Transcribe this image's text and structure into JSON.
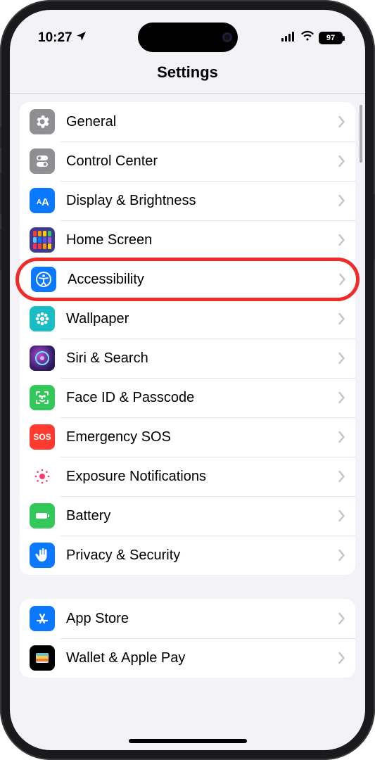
{
  "status": {
    "time": "10:27",
    "location_active": true,
    "battery": "97"
  },
  "title": "Settings",
  "highlighted_index": 4,
  "groups": [
    {
      "items": [
        {
          "id": "general",
          "label": "General",
          "icon": "gear-icon",
          "icon_class": "ic-general"
        },
        {
          "id": "control-center",
          "label": "Control Center",
          "icon": "toggles-icon",
          "icon_class": "ic-control"
        },
        {
          "id": "display",
          "label": "Display & Brightness",
          "icon": "text-size-icon",
          "icon_class": "ic-display"
        },
        {
          "id": "home-screen",
          "label": "Home Screen",
          "icon": "app-grid-icon",
          "icon_class": "ic-home"
        },
        {
          "id": "accessibility",
          "label": "Accessibility",
          "icon": "accessibility-icon",
          "icon_class": "ic-access"
        },
        {
          "id": "wallpaper",
          "label": "Wallpaper",
          "icon": "flower-icon",
          "icon_class": "ic-wall"
        },
        {
          "id": "siri",
          "label": "Siri & Search",
          "icon": "siri-icon",
          "icon_class": "ic-siri"
        },
        {
          "id": "face-id",
          "label": "Face ID & Passcode",
          "icon": "face-id-icon",
          "icon_class": "ic-face"
        },
        {
          "id": "sos",
          "label": "Emergency SOS",
          "icon": "sos-icon",
          "icon_class": "ic-sos"
        },
        {
          "id": "exposure",
          "label": "Exposure Notifications",
          "icon": "exposure-icon",
          "icon_class": "ic-expo"
        },
        {
          "id": "battery",
          "label": "Battery",
          "icon": "battery-icon",
          "icon_class": "ic-batt"
        },
        {
          "id": "privacy",
          "label": "Privacy & Security",
          "icon": "hand-icon",
          "icon_class": "ic-priv"
        }
      ]
    },
    {
      "items": [
        {
          "id": "app-store",
          "label": "App Store",
          "icon": "appstore-icon",
          "icon_class": "ic-store"
        },
        {
          "id": "wallet",
          "label": "Wallet & Apple Pay",
          "icon": "wallet-icon",
          "icon_class": "ic-wallet"
        }
      ]
    }
  ]
}
